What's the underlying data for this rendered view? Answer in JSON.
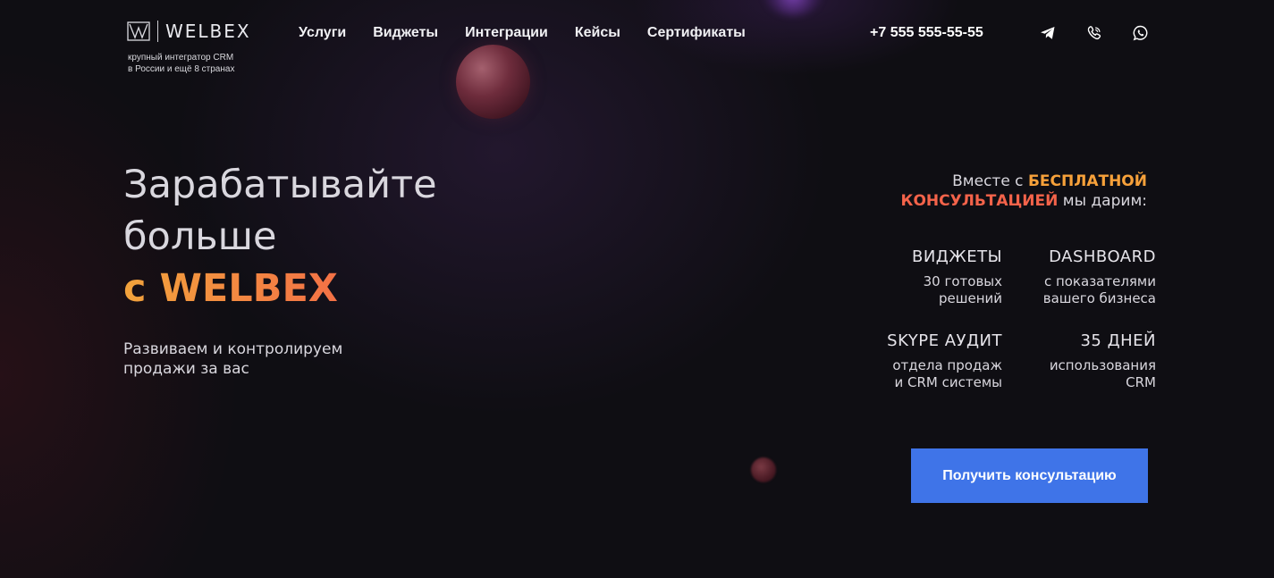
{
  "header": {
    "logo_text": "WELBEX",
    "tagline_line1": "крупный интегратор CRM",
    "tagline_line2": "в России и ещё 8 странах",
    "nav": [
      {
        "label": "Услуги"
      },
      {
        "label": "Виджеты"
      },
      {
        "label": "Интеграции"
      },
      {
        "label": "Кейсы"
      },
      {
        "label": "Сертификаты"
      }
    ],
    "phone": "+7 555 555-55-55",
    "socials": [
      {
        "icon": "telegram-icon"
      },
      {
        "icon": "viber-icon"
      },
      {
        "icon": "whatsapp-icon"
      }
    ]
  },
  "hero": {
    "title_line1": "Зарабатывайте",
    "title_line2": "больше",
    "title_accent": "с WELBEX",
    "subtitle_line1": "Развиваем и контролируем",
    "subtitle_line2": "продажи за вас"
  },
  "offer": {
    "prefix": "Вместе с ",
    "highlight1": "БЕСПЛАТНОЙ",
    "highlight2": "КОНСУЛЬТАЦИЕЙ",
    "suffix": " мы дарим:"
  },
  "features": [
    {
      "title": "ВИДЖЕТЫ",
      "desc_line1": "30 готовых",
      "desc_line2": "решений"
    },
    {
      "title": "DASHBOARD",
      "desc_line1": "с показателями",
      "desc_line2": "вашего бизнеса"
    },
    {
      "title": "SKYPE АУДИТ",
      "desc_line1": "отдела продаж",
      "desc_line2": "и CRM системы"
    },
    {
      "title": "35 ДНЕЙ",
      "desc_line1": "использования",
      "desc_line2": "CRM"
    }
  ],
  "cta": {
    "label": "Получить консультацию"
  },
  "colors": {
    "background": "#0f0e13",
    "accent_orange": "#f7a13a",
    "accent_red": "#f4634a",
    "button": "#3f74e8"
  }
}
